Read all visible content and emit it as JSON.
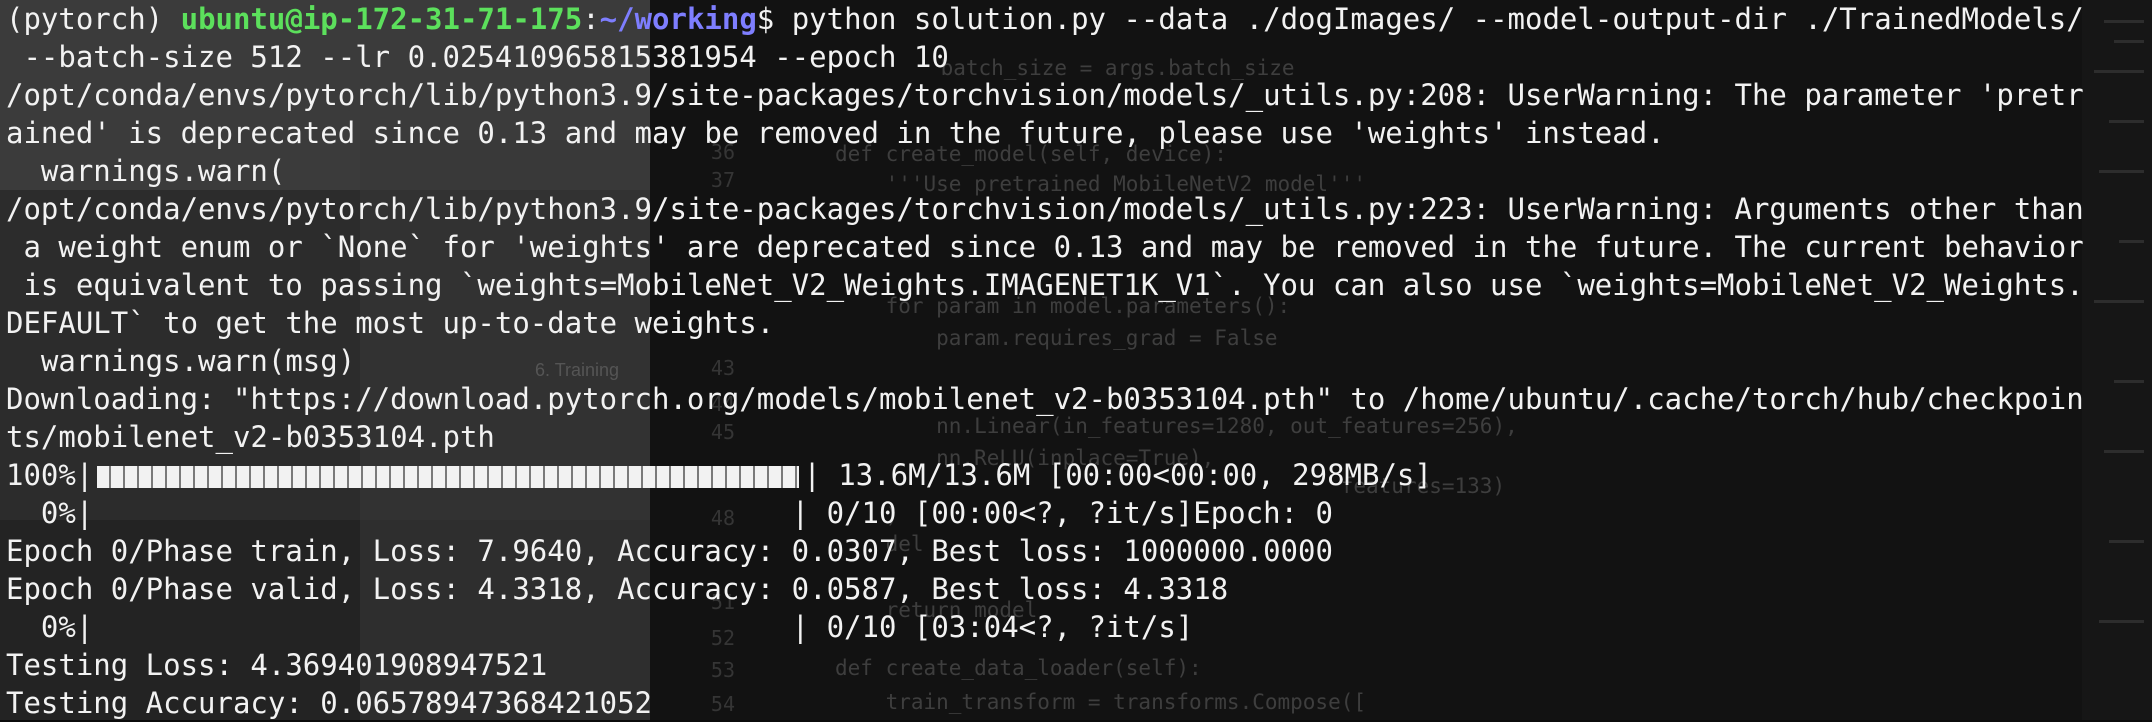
{
  "terminal": {
    "prompt": {
      "env": "(pytorch) ",
      "user_host": "ubuntu@ip-172-31-71-175",
      "sep": ":",
      "path": "~/working",
      "symbol": "$ "
    },
    "command": "python solution.py --data ./dogImages/ --model-output-dir ./TrainedModels/",
    "lines": [
      " --batch-size 512 --lr 0.025410965815381954 --epoch 10",
      "/opt/conda/envs/pytorch/lib/python3.9/site-packages/torchvision/models/_utils.py:208: UserWarning: The parameter 'pretr",
      "ained' is deprecated since 0.13 and may be removed in the future, please use 'weights' instead.",
      "  warnings.warn(",
      "/opt/conda/envs/pytorch/lib/python3.9/site-packages/torchvision/models/_utils.py:223: UserWarning: Arguments other than",
      " a weight enum or `None` for 'weights' are deprecated since 0.13 and may be removed in the future. The current behavior",
      " is equivalent to passing `weights=MobileNet_V2_Weights.IMAGENET1K_V1`. You can also use `weights=MobileNet_V2_Weights.",
      "DEFAULT` to get the most up-to-date weights.",
      "  warnings.warn(msg)",
      "Downloading: \"https://download.pytorch.org/models/mobilenet_v2-b0353104.pth\" to /home/ubuntu/.cache/torch/hub/checkpoin",
      "ts/mobilenet_v2-b0353104.pth"
    ],
    "progress": {
      "prefix": "100%|",
      "suffix": "| 13.6M/13.6M [00:00<00:00, 298MB/s]",
      "fraction": 1.0
    },
    "lines_after": [
      "  0%|                                        | 0/10 [00:00<?, ?it/s]Epoch: 0",
      "Epoch 0/Phase train, Loss: 7.9640, Accuracy: 0.0307, Best loss: 1000000.0000",
      "Epoch 0/Phase valid, Loss: 4.3318, Accuracy: 0.0587, Best loss: 4.3318",
      "  0%|                                        | 0/10 [03:04<?, ?it/s]",
      "Testing Loss: 4.369401908947521",
      "Testing Accuracy: 0.06578947368421052"
    ]
  },
  "background_editor": {
    "line_numbers": [
      "36",
      "37",
      "",
      "",
      "",
      "",
      "43",
      "44",
      "45",
      "",
      "",
      "48",
      "",
      "",
      "51",
      "52",
      "53",
      "54"
    ],
    "code_lines": [
      "    batch_size = args.batch_size",
      "def create_model(self, device):",
      "    '''Use pretrained MobileNetV2 model'''",
      "",
      "",
      "",
      "    for param in model.parameters():",
      "        param.requires_grad = False",
      "",
      "",
      "        nn.Linear(in_features=1280, out_features=256),",
      "        nn.ReLU(inplace=True),",
      "                                        features=133)",
      "    )",
      "    del",
      "",
      "    return model",
      "",
      "def create_data_loader(self):",
      "    train_transform = transforms.Compose(["
    ],
    "doc_heading": "6.  Training"
  },
  "colors": {
    "background": "#0b0b0b",
    "text": "#f2f2f2",
    "prompt_green": "#5ce05c",
    "prompt_blue": "#7e7eff"
  }
}
